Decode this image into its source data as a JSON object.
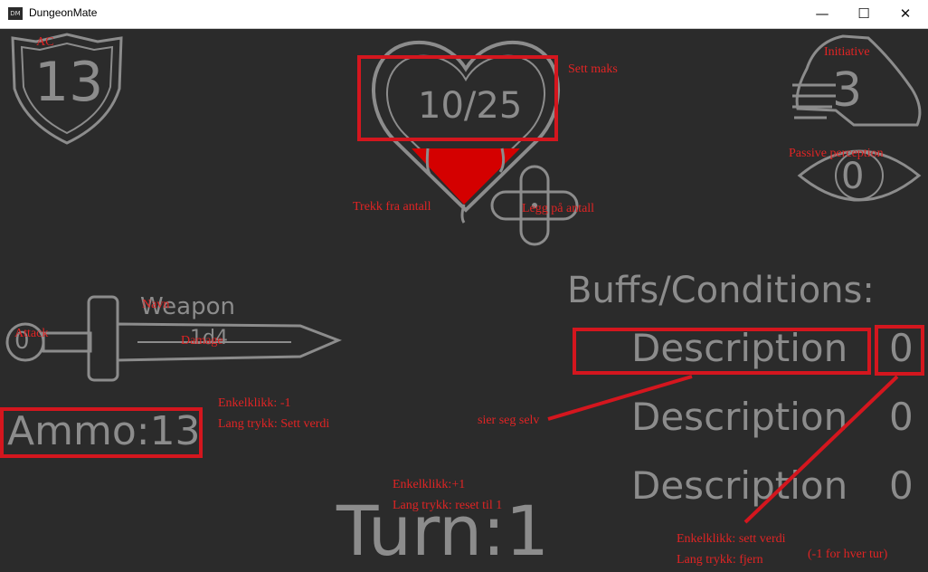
{
  "window": {
    "title": "DungeonMate",
    "icon_text": "DM",
    "min": "—",
    "max": "☐",
    "close": "✕"
  },
  "ac": {
    "value": "13",
    "label": "AC"
  },
  "health": {
    "value": "10/25",
    "label_max": "Sett maks",
    "label_minus": "Trekk fra antall",
    "label_plus": "Legg på antall"
  },
  "initiative": {
    "value": "3",
    "label": "Initiative"
  },
  "perception": {
    "value": "0",
    "label": "Passive perception"
  },
  "weapon": {
    "name": "Weapon",
    "damage": "1d4",
    "attack": "0",
    "label_name": "Navn",
    "label_damage": "Damage",
    "label_attack": "Attack"
  },
  "ammo": {
    "text": "Ammo:13",
    "note1": "Enkelklikk: -1",
    "note2": "Lang trykk: Sett verdi"
  },
  "turn": {
    "text": "Turn:1",
    "note1": "Enkelklikk:+1",
    "note2": "Lang trykk: reset til 1"
  },
  "buffs": {
    "heading": "Buffs/Conditions:",
    "items": [
      {
        "description": "Description",
        "count": "0"
      },
      {
        "description": "Description",
        "count": "0"
      },
      {
        "description": "Description",
        "count": "0"
      }
    ],
    "desc_note": "sier seg selv",
    "count_note1": "Enkelklikk: sett verdi",
    "count_note2": "Lang trykk: fjern",
    "count_note3": "(-1 for hver tur)"
  },
  "colors": {
    "background": "#2b2b2b",
    "ink": "#8c8c8c",
    "annotation": "#e02424",
    "heart_fill": "#d40000"
  }
}
